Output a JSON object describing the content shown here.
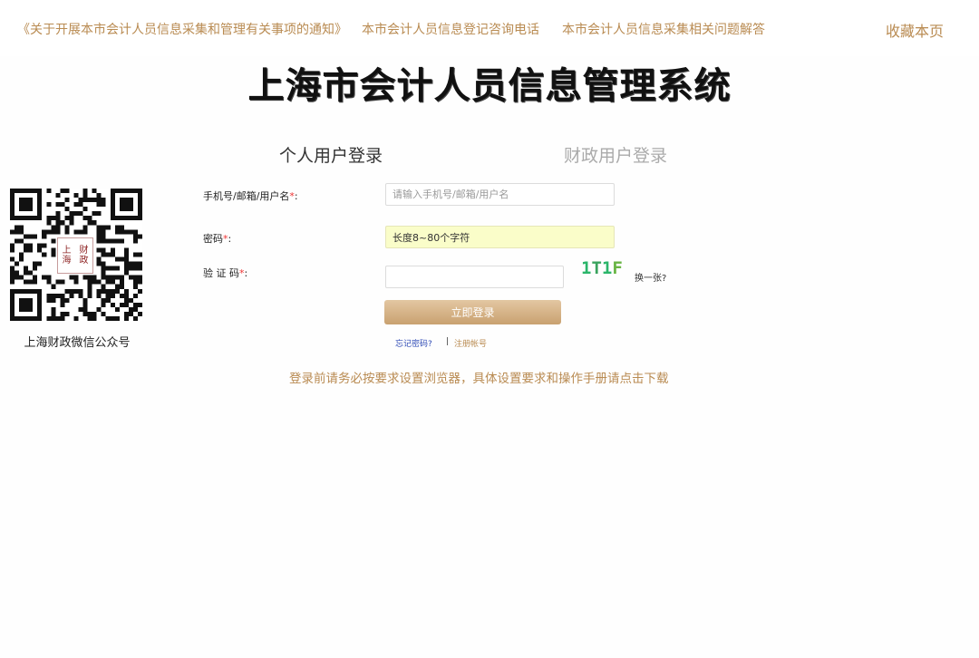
{
  "top_nav": {
    "links": [
      "《关于开展本市会计人员信息采集和管理有关事项的通知》",
      "本市会计人员信息登记咨询电话",
      "本市会计人员信息采集相关问题解答"
    ],
    "bookmark": "收藏本页"
  },
  "site_title": "上海市会计人员信息管理系统",
  "tabs": {
    "personal": "个人用户登录",
    "finance": "财政用户登录"
  },
  "qr": {
    "seal_text": "上海财政",
    "caption": "上海财政微信公众号"
  },
  "form": {
    "username": {
      "label": "手机号/邮箱/用户名",
      "required_mark": "*",
      "colon": ":",
      "placeholder": "请输入手机号/邮箱/用户名",
      "value": ""
    },
    "password": {
      "label": "密码",
      "required_mark": "*",
      "colon": ":",
      "value": "长度8~80个字符"
    },
    "captcha": {
      "label": "验 证 码",
      "required_mark": "*",
      "colon": ":",
      "value": "",
      "image_chars": [
        "1",
        "T",
        "1",
        "F"
      ],
      "refresh_label": "换一张?"
    },
    "login_button": "立即登录",
    "forgot_password": "忘记密码?",
    "separator": "|",
    "register": "注册帐号"
  },
  "notice": "登录前请务必按要求设置浏览器，具体设置要求和操作手册请点击下载",
  "colors": {
    "accent_gold": "#b98b52",
    "link_blue": "#2f4bb5",
    "captcha_green": "#2bb56a",
    "required_red": "#e33333"
  }
}
